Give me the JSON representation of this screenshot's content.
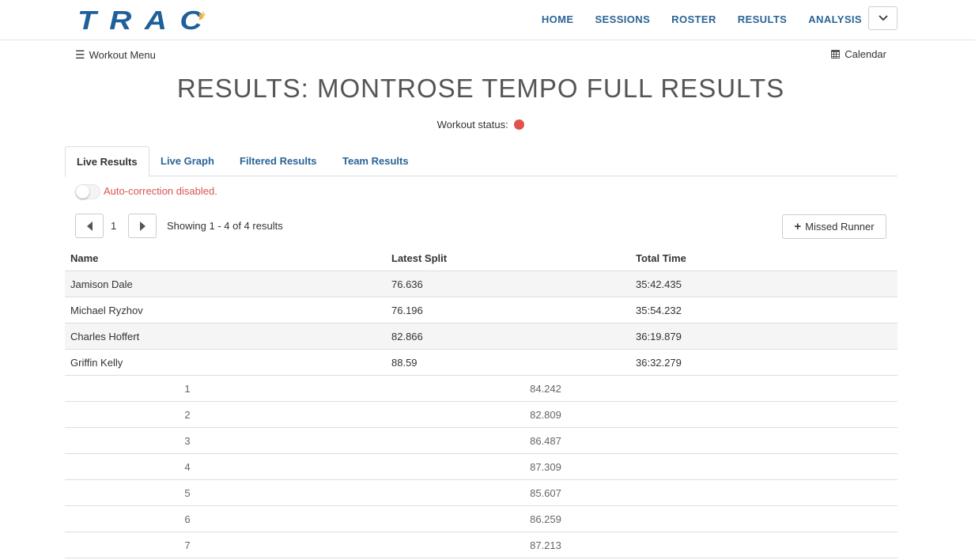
{
  "navbar": {
    "brand": "TRAC",
    "links": [
      "HOME",
      "SESSIONS",
      "ROSTER",
      "RESULTS",
      "ANALYSIS"
    ]
  },
  "subheader": {
    "workout_menu": "Workout Menu",
    "calendar": "Calendar"
  },
  "page_title": "RESULTS: MONTROSE TEMPO FULL RESULTS",
  "status": {
    "label": "Workout status:",
    "color": "#e0524c"
  },
  "tabs": [
    "Live Results",
    "Live Graph",
    "Filtered Results",
    "Team Results"
  ],
  "auto_correction": {
    "label": "Auto-correction disabled.",
    "enabled": false
  },
  "pagination": {
    "current_page": "1",
    "showing": "Showing 1 - 4 of 4 results"
  },
  "missed_runner_label": "Missed Runner",
  "table": {
    "headers": [
      "Name",
      "Latest Split",
      "Total Time"
    ],
    "rows": [
      {
        "name": "Jamison Dale",
        "latest_split": "76.636",
        "total_time": "35:42.435"
      },
      {
        "name": "Michael Ryzhov",
        "latest_split": "76.196",
        "total_time": "35:54.232"
      },
      {
        "name": "Charles Hoffert",
        "latest_split": "82.866",
        "total_time": "36:19.879"
      },
      {
        "name": "Griffin Kelly",
        "latest_split": "88.59",
        "total_time": "36:32.279"
      }
    ],
    "expanded_splits": [
      {
        "index": "1",
        "value": "84.242"
      },
      {
        "index": "2",
        "value": "82.809"
      },
      {
        "index": "3",
        "value": "86.487"
      },
      {
        "index": "4",
        "value": "87.309"
      },
      {
        "index": "5",
        "value": "85.607"
      },
      {
        "index": "6",
        "value": "86.259"
      },
      {
        "index": "7",
        "value": "87.213"
      }
    ]
  }
}
